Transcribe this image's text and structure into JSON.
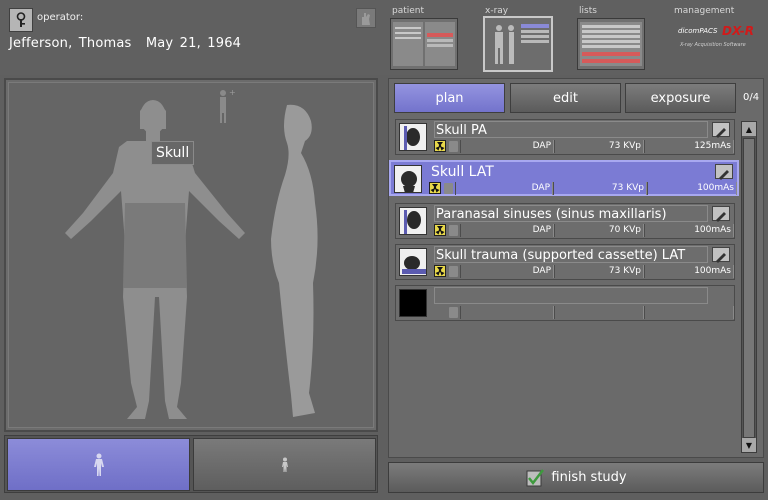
{
  "header": {
    "operator_label": "operator:",
    "patient_name": "Jefferson,  Thomas",
    "patient_dob": "May 21, 1964"
  },
  "top_tabs": [
    {
      "label": "patient"
    },
    {
      "label": "x-ray"
    },
    {
      "label": "lists"
    },
    {
      "label": "management"
    }
  ],
  "brand": {
    "name_prefix": "dicomPACS",
    "name_suffix": "DX-R",
    "tagline": "X-ray Acquisition Software"
  },
  "body_map": {
    "selected_region": "Skull"
  },
  "modes": {
    "plan": "plan",
    "edit": "edit",
    "exposure": "exposure",
    "counter": "0/4"
  },
  "exams": [
    {
      "title": "Skull PA",
      "dose_label": "DAP",
      "kvp": "73 KVp",
      "mas": "125mAs",
      "selected": false
    },
    {
      "title": "Skull LAT",
      "dose_label": "DAP",
      "kvp": "73 KVp",
      "mas": "100mAs",
      "selected": true
    },
    {
      "title": "Paranasal sinuses (sinus maxillaris)",
      "dose_label": "DAP",
      "kvp": "70 KVp",
      "mas": "100mAs",
      "selected": false
    },
    {
      "title": "Skull trauma (supported cassette) LAT",
      "dose_label": "DAP",
      "kvp": "73 KVp",
      "mas": "100mAs",
      "selected": false
    },
    {
      "title": "",
      "dose_label": "",
      "kvp": "",
      "mas": "",
      "selected": false
    }
  ],
  "finish_label": "finish study",
  "colors": {
    "accent": "#7b7bd4",
    "panel": "#6a6a6a",
    "radiation": "#e8d84a",
    "brand_red": "#d11a1a"
  }
}
